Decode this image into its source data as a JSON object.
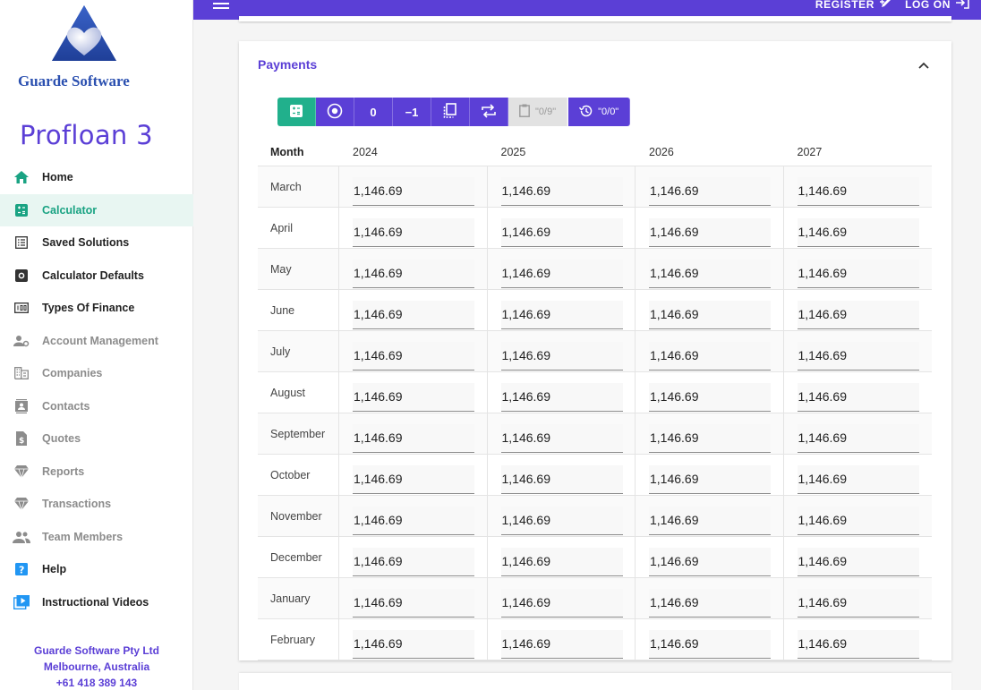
{
  "sidebar": {
    "logo_text": "Guarde Software",
    "app_name": "Profloan 3",
    "items": [
      {
        "label": "Home",
        "icon": "home-icon",
        "state": "normal"
      },
      {
        "label": "Calculator",
        "icon": "calculator-icon",
        "state": "active"
      },
      {
        "label": "Saved Solutions",
        "icon": "list-icon",
        "state": "normal"
      },
      {
        "label": "Calculator Defaults",
        "icon": "settings-box-icon",
        "state": "normal"
      },
      {
        "label": "Types Of Finance",
        "icon": "counter-icon",
        "state": "normal"
      },
      {
        "label": "Account Management",
        "icon": "account-cog-icon",
        "state": "dim"
      },
      {
        "label": "Companies",
        "icon": "domain-icon",
        "state": "dim"
      },
      {
        "label": "Contacts",
        "icon": "contacts-icon",
        "state": "dim"
      },
      {
        "label": "Quotes",
        "icon": "file-dollar-icon",
        "state": "dim"
      },
      {
        "label": "Reports",
        "icon": "diamond-icon",
        "state": "dim"
      },
      {
        "label": "Transactions",
        "icon": "diamond-icon",
        "state": "dim"
      },
      {
        "label": "Team Members",
        "icon": "team-icon",
        "state": "dim"
      },
      {
        "label": "Help",
        "icon": "help-icon",
        "state": "normal"
      },
      {
        "label": "Instructional Videos",
        "icon": "video-icon",
        "state": "normal"
      }
    ],
    "company": {
      "name": "Guarde Software Pty Ltd",
      "city": "Melbourne, Australia",
      "phone": "+61 418 389 143"
    }
  },
  "topbar": {
    "register_label": "REGISTER",
    "logon_label": "LOG ON"
  },
  "payments": {
    "title": "Payments",
    "toolbar": {
      "zero_label": "0",
      "minus_label": "−1",
      "paste_label": "\"0/9\"",
      "history_label": "\"0/0\""
    },
    "columns": [
      "Month",
      "2024",
      "2025",
      "2026",
      "2027"
    ],
    "rows": [
      {
        "month": "March",
        "values": [
          "1,146.69",
          "1,146.69",
          "1,146.69",
          "1,146.69"
        ]
      },
      {
        "month": "April",
        "values": [
          "1,146.69",
          "1,146.69",
          "1,146.69",
          "1,146.69"
        ]
      },
      {
        "month": "May",
        "values": [
          "1,146.69",
          "1,146.69",
          "1,146.69",
          "1,146.69"
        ]
      },
      {
        "month": "June",
        "values": [
          "1,146.69",
          "1,146.69",
          "1,146.69",
          "1,146.69"
        ]
      },
      {
        "month": "July",
        "values": [
          "1,146.69",
          "1,146.69",
          "1,146.69",
          "1,146.69"
        ]
      },
      {
        "month": "August",
        "values": [
          "1,146.69",
          "1,146.69",
          "1,146.69",
          "1,146.69"
        ]
      },
      {
        "month": "September",
        "values": [
          "1,146.69",
          "1,146.69",
          "1,146.69",
          "1,146.69"
        ]
      },
      {
        "month": "October",
        "values": [
          "1,146.69",
          "1,146.69",
          "1,146.69",
          "1,146.69"
        ]
      },
      {
        "month": "November",
        "values": [
          "1,146.69",
          "1,146.69",
          "1,146.69",
          "1,146.69"
        ]
      },
      {
        "month": "December",
        "values": [
          "1,146.69",
          "1,146.69",
          "1,146.69",
          "1,146.69"
        ]
      },
      {
        "month": "January",
        "values": [
          "1,146.69",
          "1,146.69",
          "1,146.69",
          "1,146.69"
        ]
      },
      {
        "month": "February",
        "values": [
          "1,146.69",
          "1,146.69",
          "1,146.69",
          "1,146.69"
        ]
      }
    ]
  },
  "colors": {
    "primary": "#5b3fd6",
    "accent": "#21b08c",
    "active_bg": "#e8f6f2"
  }
}
